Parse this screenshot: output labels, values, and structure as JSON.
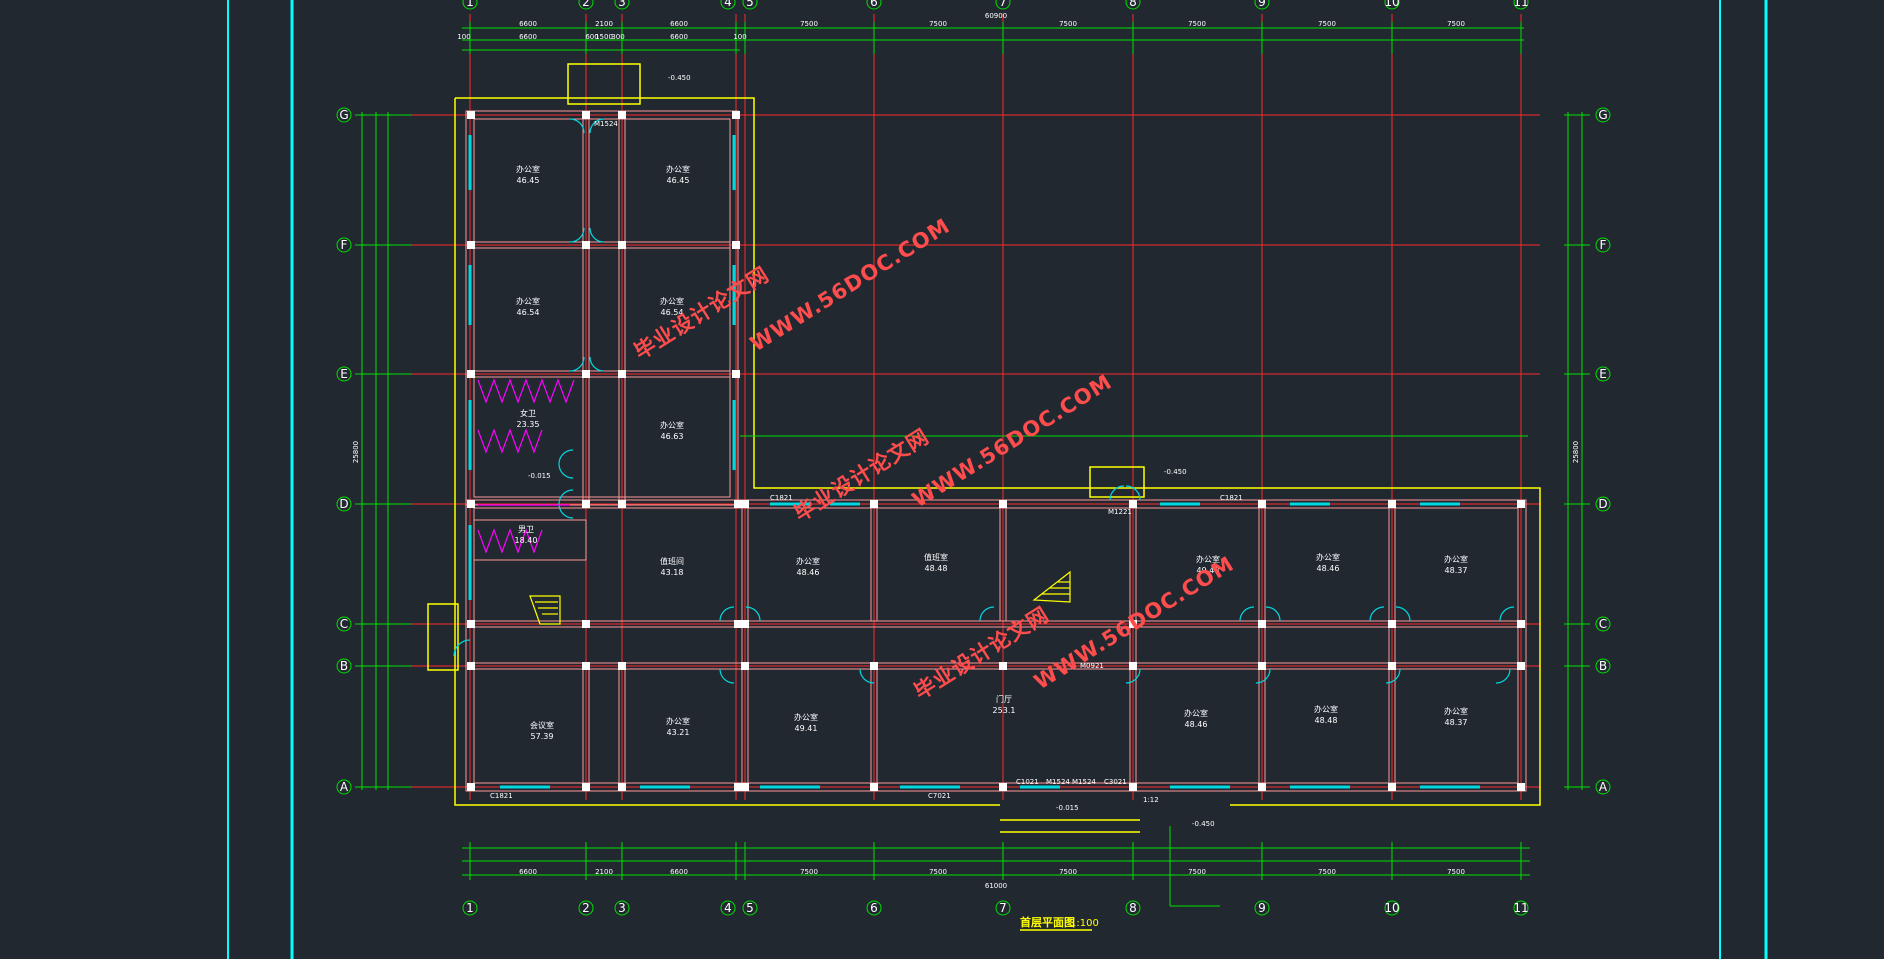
{
  "drawing": {
    "title": "首层平面图",
    "scale": "1:100",
    "colors": {
      "background": "#212830",
      "axis": "#ff2a2a",
      "dimension": "#00e000",
      "wall": "#ff9898",
      "outline": "#ffff00",
      "window": "#00d8e0",
      "fixture": "#ff00ff",
      "frame": "#00ffff"
    },
    "top_axes": [
      "1",
      "2",
      "3",
      "4",
      "5",
      "6",
      "7",
      "8",
      "9",
      "10",
      "11"
    ],
    "side_axes": [
      "G",
      "F",
      "E",
      "D",
      "C",
      "B",
      "A"
    ],
    "top_total": "60900",
    "bottom_total": "61000",
    "right_total": "25800",
    "left_total": "25800",
    "top_row1": [
      "6600",
      "2100",
      "6600",
      "7500",
      "7500",
      "7500",
      "7500",
      "7500",
      "7500"
    ],
    "top_row2": [
      "100",
      "6600",
      "600",
      "1500",
      "300",
      "6600",
      "100"
    ],
    "bottom_row1": [
      "6600",
      "2100",
      "6600",
      "7500",
      "7500",
      "7500",
      "7500",
      "7500",
      "7500"
    ],
    "rooms": [
      {
        "name": "办公室",
        "area": "46.45"
      },
      {
        "name": "办公室",
        "area": "46.45"
      },
      {
        "name": "办公室",
        "area": "46.54"
      },
      {
        "name": "办公室",
        "area": "46.54"
      },
      {
        "name": "女卫",
        "area": "23.35"
      },
      {
        "name": "办公室",
        "area": "46.63"
      },
      {
        "name": "男卫",
        "area": "18.40"
      },
      {
        "name": "值班间",
        "area": "43.18"
      },
      {
        "name": "办公室",
        "area": "48.46"
      },
      {
        "name": "值班室",
        "area": "48.48"
      },
      {
        "name": "办公室",
        "area": "49.48"
      },
      {
        "name": "办公室",
        "area": "48.46"
      },
      {
        "name": "办公室",
        "area": "48.37"
      },
      {
        "name": "会议室",
        "area": "57.39"
      },
      {
        "name": "办公室",
        "area": "43.21"
      },
      {
        "name": "办公室",
        "area": "49.41"
      },
      {
        "name": "门厅",
        "area": "253.1"
      },
      {
        "name": "办公室",
        "area": "48.46"
      },
      {
        "name": "办公室",
        "area": "48.48"
      },
      {
        "name": "办公室",
        "area": "48.37"
      }
    ],
    "elevations": [
      "-0.450",
      "-0.015",
      "-0.450",
      "-0.015",
      "-0.450"
    ],
    "door_labels": [
      "M1524",
      "M0921",
      "M1221",
      "M1524",
      "M1524"
    ],
    "window_labels": [
      "C1821",
      "C1821",
      "C1821",
      "C7021",
      "C3021",
      "C1021"
    ],
    "slope_label": "1:12",
    "watermarks": [
      "毕业设计论文网",
      "WWW.56DOC.COM"
    ]
  }
}
